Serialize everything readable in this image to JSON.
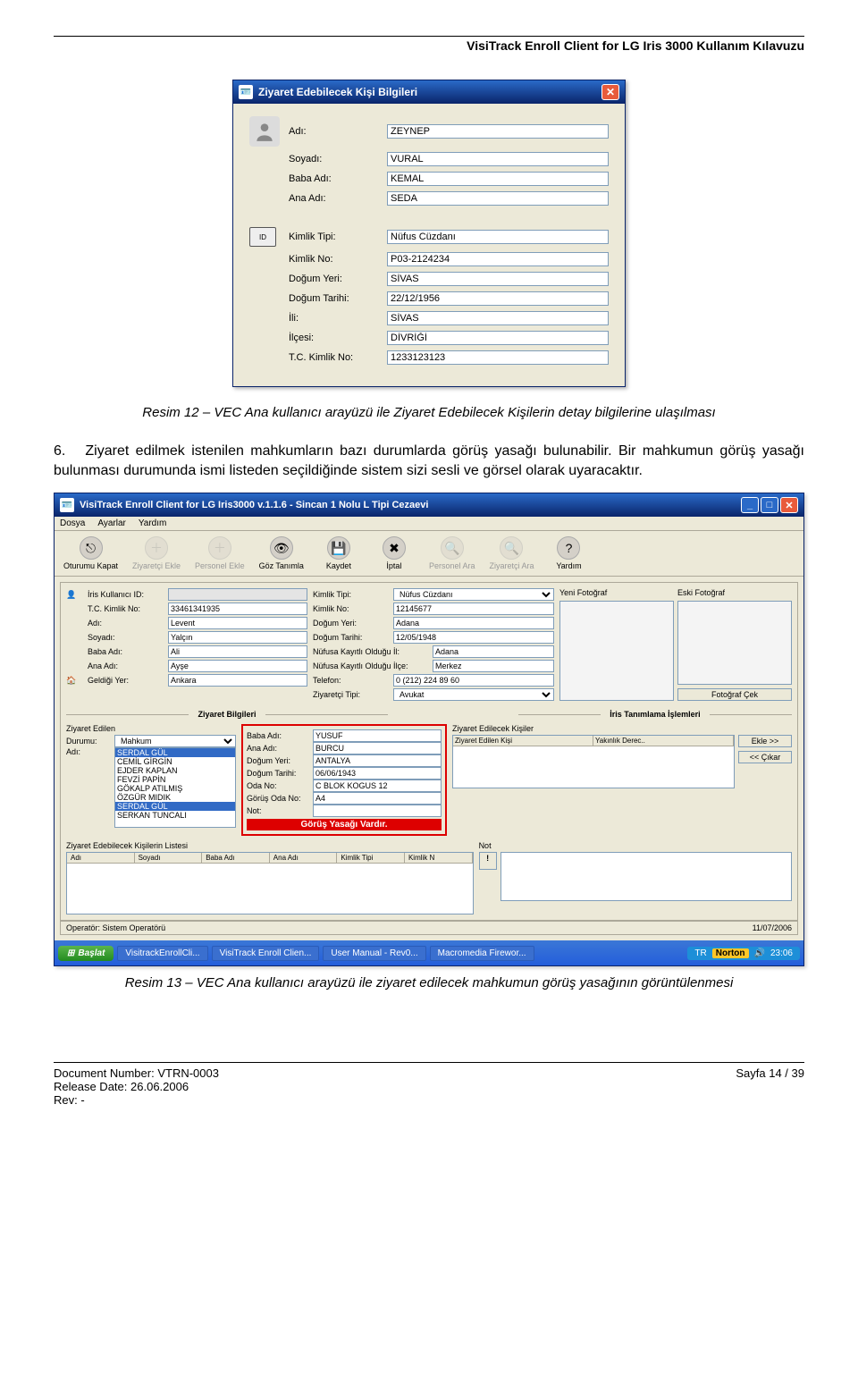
{
  "header": {
    "title": "VisiTrack Enroll Client for LG Iris 3000 Kullanım Kılavuzu"
  },
  "dlg1": {
    "title": "Ziyaret Edebilecek Kişi Bilgileri",
    "labels": {
      "adi": "Adı:",
      "soyadi": "Soyadı:",
      "baba": "Baba Adı:",
      "ana": "Ana Adı:",
      "kimlik_tipi": "Kimlik Tipi:",
      "kimlik_no": "Kimlik No:",
      "dogum_yeri": "Doğum Yeri:",
      "dogum_tarihi": "Doğum Tarihi:",
      "ili": "İli:",
      "ilcesi": "İlçesi:",
      "tc": "T.C. Kimlik No:"
    },
    "values": {
      "adi": "ZEYNEP",
      "soyadi": "VURAL",
      "baba": "KEMAL",
      "ana": "SEDA",
      "kimlik_tipi": "Nüfus Cüzdanı",
      "kimlik_no": "P03-2124234",
      "dogum_yeri": "SİVAS",
      "dogum_tarihi": "22/12/1956",
      "ili": "SİVAS",
      "ilcesi": "DİVRİĞİ",
      "tc": "1233123123"
    }
  },
  "caption1": "Resim 12 – VEC Ana kullanıcı arayüzü ile Ziyaret Edebilecek Kişilerin detay bilgilerine ulaşılması",
  "para6_num": "6.",
  "para6": "Ziyaret edilmek istenilen mahkumların bazı durumlarda görüş yasağı bulunabilir. Bir mahkumun görüş yasağı bulunması durumunda ismi listeden seçildiğinde sistem sizi sesli ve görsel olarak uyaracaktır.",
  "app": {
    "title": "VisiTrack Enroll Client for LG Iris3000 v.1.1.6 - Sincan 1 Nolu L Tipi Cezaevi",
    "menu": [
      "Dosya",
      "Ayarlar",
      "Yardım"
    ],
    "toolbar": [
      {
        "label": "Oturumu Kapat",
        "glyph": "⎋"
      },
      {
        "label": "Ziyaretçi Ekle",
        "glyph": "＋",
        "disabled": true
      },
      {
        "label": "Personel Ekle",
        "glyph": "＋",
        "disabled": true
      },
      {
        "label": "Göz Tanımla",
        "glyph": "👁"
      },
      {
        "label": "Kaydet",
        "glyph": "💾"
      },
      {
        "label": "İptal",
        "glyph": "✖"
      },
      {
        "label": "Personel Ara",
        "glyph": "🔍",
        "disabled": true
      },
      {
        "label": "Ziyaretçi Ara",
        "glyph": "🔍",
        "disabled": true
      },
      {
        "label": "Yardım",
        "glyph": "?"
      }
    ],
    "left": {
      "iris_id_lbl": "İris Kullanıcı ID:",
      "iris_id": "",
      "tc_lbl": "T.C. Kimlik No:",
      "tc": "33461341935",
      "adi_lbl": "Adı:",
      "adi": "Levent",
      "soyadi_lbl": "Soyadı:",
      "soyadi": "Yalçın",
      "baba_lbl": "Baba Adı:",
      "baba": "Ali",
      "ana_lbl": "Ana Adı:",
      "ana": "Ayşe",
      "geldi_lbl": "Geldiği Yer:",
      "geldi": "Ankara"
    },
    "mid": {
      "kimlik_tipi_lbl": "Kimlik Tipi:",
      "kimlik_tipi": "Nüfus Cüzdanı",
      "kimlik_no_lbl": "Kimlik No:",
      "kimlik_no": "12145677",
      "dogum_yeri_lbl": "Doğum Yeri:",
      "dogum_yeri": "Adana",
      "dogum_tarihi_lbl": "Doğum Tarihi:",
      "dogum_tarihi": "12/05/1948",
      "nko_il_lbl": "Nüfusa Kayıtlı Olduğu İl:",
      "nko_il": "Adana",
      "nko_ilce_lbl": "Nüfusa Kayıtlı Olduğu İlçe:",
      "nko_ilce": "Merkez",
      "telefon_lbl": "Telefon:",
      "telefon": "0 (212) 224 89 60",
      "ztipi_lbl": "Ziyaretçi Tipi:",
      "ztipi": "Avukat"
    },
    "photos": {
      "yeni": "Yeni Fotoğraf",
      "eski": "Eski Fotoğraf",
      "cek": "Fotoğraf Çek"
    },
    "sections": {
      "ziyaret": "Ziyaret Bilgileri",
      "iris": "İris Tanımlama İşlemleri"
    },
    "ziyaret_edilen": {
      "title": "Ziyaret Edilen",
      "durumu_lbl": "Durumu:",
      "durumu": "Mahkum",
      "adi_lbl": "Adı:",
      "list": [
        "SERDAL GÜL",
        "CEMİL GİRGİN",
        "EJDER KAPLAN",
        "FEVZİ PAPİN",
        "GÖKALP ATILMIŞ",
        "ÖZGÜR MIDIK",
        "SERDAL GÜL",
        "SERKAN TUNCALI"
      ],
      "selected": "SERDAL GÜL"
    },
    "mahkum_detay": {
      "baba_lbl": "Baba Adı:",
      "baba": "YUSUF",
      "ana_lbl": "Ana Adı:",
      "ana": "BURCU",
      "dy_lbl": "Doğum Yeri:",
      "dy": "ANTALYA",
      "dt_lbl": "Doğum Tarihi:",
      "dt": "06/06/1943",
      "oda_lbl": "Oda No:",
      "oda": "C BLOK KOGUS 12",
      "goda_lbl": "Görüş Oda No:",
      "goda": "A4",
      "not_lbl": "Not:",
      "yasak": "Görüş Yasağı Vardır."
    },
    "zek": {
      "title": "Ziyaret Edilecek Kişiler",
      "cols": [
        "Ziyaret Edilen Kişi",
        "Yakınlık Derec.."
      ],
      "ekle": "Ekle >>",
      "cikar": "<< Çıkar"
    },
    "list2": {
      "title": "Ziyaret Edebilecek Kişilerin Listesi",
      "cols": [
        "Adı",
        "Soyadı",
        "Baba Adı",
        "Ana Adı",
        "Kimlik Tipi",
        "Kimlik N"
      ]
    },
    "notpanel": {
      "title": "Not",
      "icon": "!"
    },
    "status": {
      "operator_lbl": "Operatör:",
      "operator": "Sistem Operatörü",
      "date": "11/07/2006"
    },
    "taskbar": {
      "start": "Başlat",
      "tasks": [
        "VisitrackEnrollCli...",
        "VisiTrack Enroll Clien...",
        "User Manual - Rev0...",
        "Macromedia Firewor..."
      ],
      "lang": "TR",
      "norton": "Norton",
      "clock": "23:06"
    }
  },
  "caption2": "Resim 13 – VEC Ana kullanıcı arayüzü ile ziyaret edilecek mahkumun görüş yasağının görüntülenmesi",
  "footer": {
    "doc_lbl": "Document Number:",
    "doc": "VTRN-0003",
    "date_lbl": "Release Date:",
    "date": "26.06.2006",
    "rev_lbl": "Rev:",
    "rev": "-",
    "page": "Sayfa 14 / 39"
  }
}
